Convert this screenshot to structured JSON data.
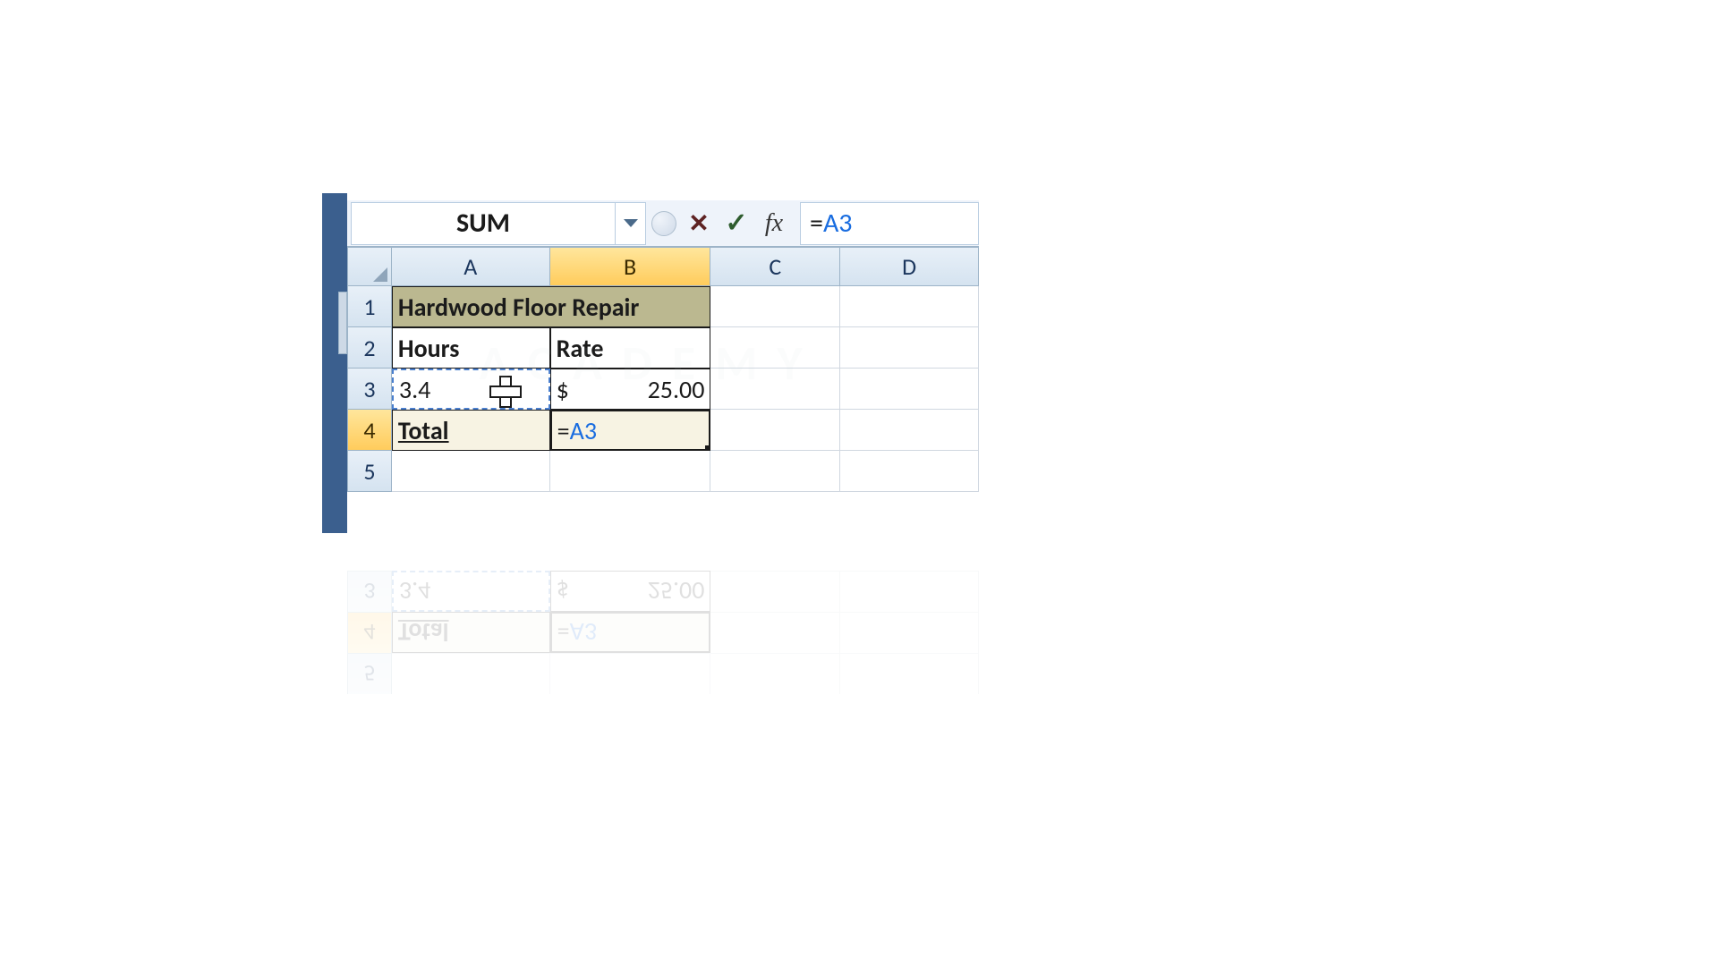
{
  "formula_bar": {
    "name_box": "SUM",
    "cancel_glyph": "✕",
    "enter_glyph": "✓",
    "fx_glyph": "fx",
    "formula_eq": "=",
    "formula_ref": "A3"
  },
  "columns": {
    "A": "A",
    "B": "B",
    "C": "C",
    "D": "D"
  },
  "rows": {
    "r1": "1",
    "r2": "2",
    "r3": "3",
    "r4": "4",
    "r5": "5"
  },
  "cells": {
    "A1": "Hardwood Floor Repair",
    "A2": "Hours",
    "B2": "Rate",
    "A3": "3.4",
    "B3_currency": "$",
    "B3_value": "25.00",
    "A4": "Total",
    "B4_eq": "=",
    "B4_ref": "A3"
  },
  "colors": {
    "accent_blue": "#3b5f8e",
    "header_olive": "#bbb890",
    "active_col": "#ffcc5c",
    "ref_blue": "#1a6de0"
  },
  "watermark": "ACADEMY",
  "chart_data": {
    "type": "table",
    "title": "Hardwood Floor Repair",
    "columns": [
      "Hours",
      "Rate"
    ],
    "rows": [
      [
        3.4,
        25.0
      ]
    ],
    "editing_formula": "=A3",
    "active_cell": "B4",
    "referenced_cell": "A3",
    "name_box_value": "SUM"
  }
}
